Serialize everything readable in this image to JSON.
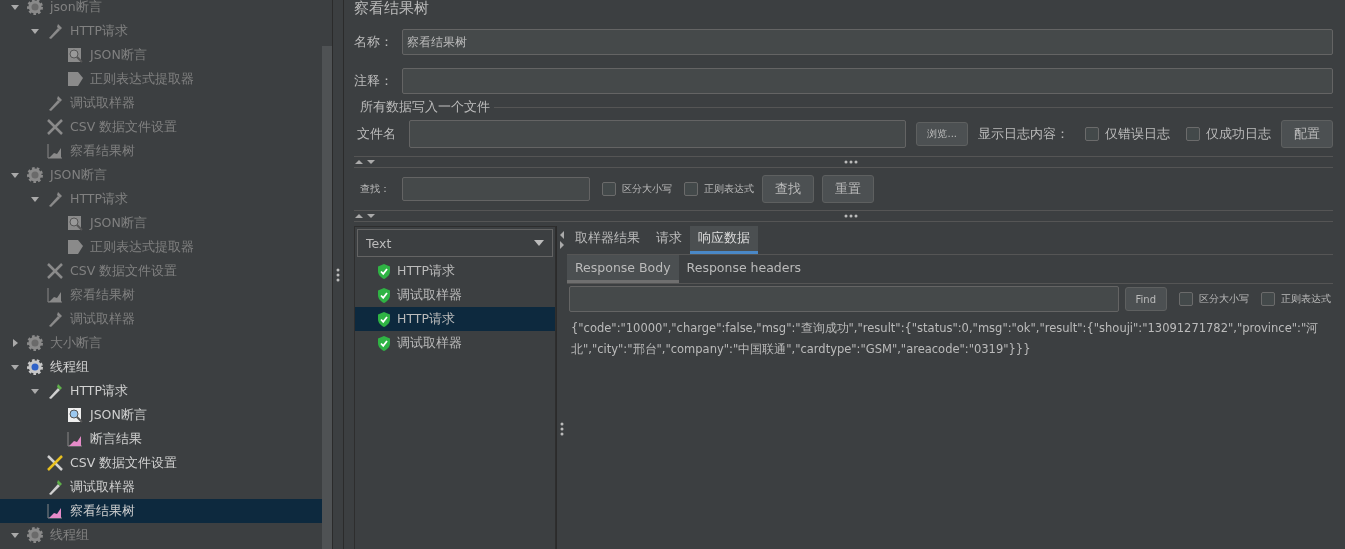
{
  "tree": [
    {
      "label": "json断言",
      "kind": "thread-group",
      "disabled": true,
      "expanded": true,
      "selected": false,
      "children": [
        {
          "label": "HTTP请求",
          "kind": "sampler",
          "disabled": true,
          "expanded": true,
          "selected": false,
          "children": [
            {
              "label": "JSON断言",
              "kind": "assertion",
              "disabled": true,
              "selected": false
            },
            {
              "label": "正则表达式提取器",
              "kind": "extractor",
              "disabled": true,
              "selected": false
            }
          ]
        },
        {
          "label": "调试取样器",
          "kind": "sampler",
          "disabled": true,
          "selected": false
        },
        {
          "label": "CSV 数据文件设置",
          "kind": "config",
          "disabled": true,
          "selected": false
        },
        {
          "label": "察看结果树",
          "kind": "listener",
          "disabled": true,
          "selected": false
        }
      ]
    },
    {
      "label": "JSON断言",
      "kind": "thread-group",
      "disabled": true,
      "expanded": true,
      "selected": false,
      "children": [
        {
          "label": "HTTP请求",
          "kind": "sampler",
          "disabled": true,
          "expanded": true,
          "selected": false,
          "children": [
            {
              "label": "JSON断言",
              "kind": "assertion",
              "disabled": true,
              "selected": false
            },
            {
              "label": "正则表达式提取器",
              "kind": "extractor",
              "disabled": true,
              "selected": false
            }
          ]
        },
        {
          "label": "CSV 数据文件设置",
          "kind": "config",
          "disabled": true,
          "selected": false
        },
        {
          "label": "察看结果树",
          "kind": "listener",
          "disabled": true,
          "selected": false
        },
        {
          "label": "调试取样器",
          "kind": "sampler",
          "disabled": true,
          "selected": false
        }
      ]
    },
    {
      "label": "大小断言",
      "kind": "thread-group",
      "disabled": true,
      "expanded": false,
      "selected": false
    },
    {
      "label": "线程组",
      "kind": "thread-group",
      "disabled": false,
      "expanded": true,
      "selected": false,
      "children": [
        {
          "label": "HTTP请求",
          "kind": "sampler",
          "disabled": false,
          "expanded": true,
          "selected": false,
          "children": [
            {
              "label": "JSON断言",
              "kind": "assertion",
              "disabled": false,
              "selected": false
            },
            {
              "label": "断言结果",
              "kind": "listener",
              "disabled": false,
              "selected": false
            }
          ]
        },
        {
          "label": "CSV 数据文件设置",
          "kind": "config",
          "disabled": false,
          "selected": false
        },
        {
          "label": "调试取样器",
          "kind": "sampler",
          "disabled": false,
          "selected": false
        },
        {
          "label": "察看结果树",
          "kind": "listener",
          "disabled": false,
          "selected": true
        }
      ]
    },
    {
      "label": "线程组",
      "kind": "thread-group",
      "disabled": true,
      "expanded": true,
      "selected": false
    }
  ],
  "editor": {
    "title": "察看结果树",
    "name_label": "名称：",
    "name_value": "察看结果树",
    "comment_label": "注释：",
    "file_group": {
      "legend": "所有数据写入一个文件",
      "file_label": "文件名",
      "browse_button": "浏览...",
      "log_label": "显示日志内容：",
      "log_options": [
        {
          "label": "仅错误日志",
          "checked": false
        },
        {
          "label": "仅成功日志",
          "checked": false
        }
      ],
      "config_button": "配置"
    },
    "search": {
      "label": "查找：",
      "options": [
        {
          "label": "区分大小写",
          "checked": false
        },
        {
          "label": "正则表达式",
          "checked": false
        }
      ],
      "find_button": "查找",
      "reset_button": "重置"
    }
  },
  "results": {
    "renderer": "Text",
    "samples": [
      {
        "label": "HTTP请求",
        "success": true,
        "selected": false
      },
      {
        "label": "调试取样器",
        "success": true,
        "selected": false
      },
      {
        "label": "HTTP请求",
        "success": true,
        "selected": true
      },
      {
        "label": "调试取样器",
        "success": true,
        "selected": false
      }
    ]
  },
  "tabs": [
    {
      "label": "取样器结果",
      "selected": false
    },
    {
      "label": "请求",
      "selected": false
    },
    {
      "label": "响应数据",
      "selected": true
    }
  ],
  "subtabs": [
    {
      "label": "Response Body",
      "selected": true
    },
    {
      "label": "Response headers",
      "selected": false
    }
  ],
  "find": {
    "button": "Find",
    "options": [
      {
        "label": "区分大小写",
        "checked": false
      },
      {
        "label": "正则表达式",
        "checked": false
      }
    ]
  },
  "response_body": "{\"code\":\"10000\",\"charge\":false,\"msg\":\"查询成功\",\"result\":{\"status\":0,\"msg\":\"ok\",\"result\":{\"shouji\":\"13091271782\",\"province\":\"河北\",\"city\":\"邢台\",\"company\":\"中国联通\",\"cardtype\":\"GSM\",\"areacode\":\"0319\"}}}"
}
